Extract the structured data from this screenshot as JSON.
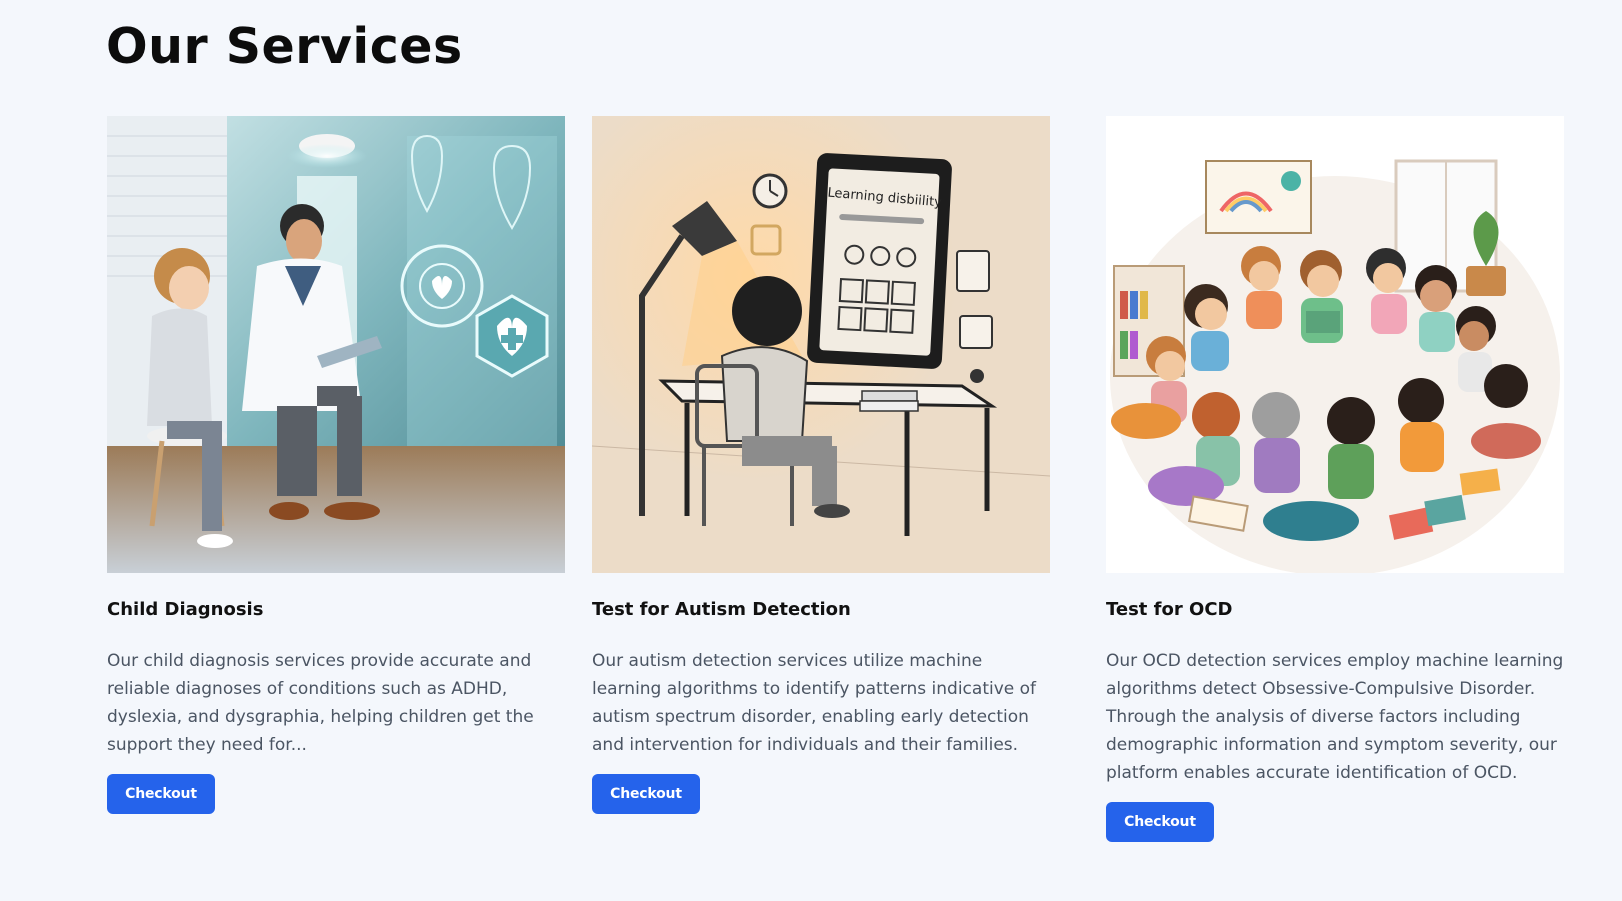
{
  "section": {
    "title": "Our Services"
  },
  "services": [
    {
      "title": "Child Diagnosis",
      "description": "Our child diagnosis services provide accurate and reliable diagnoses of conditions such as ADHD, dyslexia, and dysgraphia, helping children get the support they need for...",
      "button_label": "Checkout",
      "image": "doctor-child-diagnosis-illustration",
      "image_alt": "Doctor examining a child with a tablet"
    },
    {
      "title": "Test for Autism Detection",
      "description": "Our autism detection services utilize machine learning algorithms to identify patterns indicative of autism spectrum disorder, enabling early detection and intervention for individuals and their families.",
      "button_label": "Checkout",
      "image": "child-learning-disability-test-illustration",
      "image_text": "Learning disbiility",
      "image_alt": "Child sitting at a desk facing a tablet"
    },
    {
      "title": "Test for OCD",
      "description": "Our OCD detection services employ machine learning algorithms detect Obsessive-Compulsive Disorder. Through the analysis of diverse factors including demographic information and symptom severity, our platform enables accurate identification of OCD.",
      "button_label": "Checkout",
      "image": "children-circle-reading-illustration",
      "image_alt": "Children sitting in a circle reading"
    }
  ],
  "colors": {
    "background": "#f4f7fc",
    "button": "#2563eb",
    "body_text": "#4b5563"
  }
}
